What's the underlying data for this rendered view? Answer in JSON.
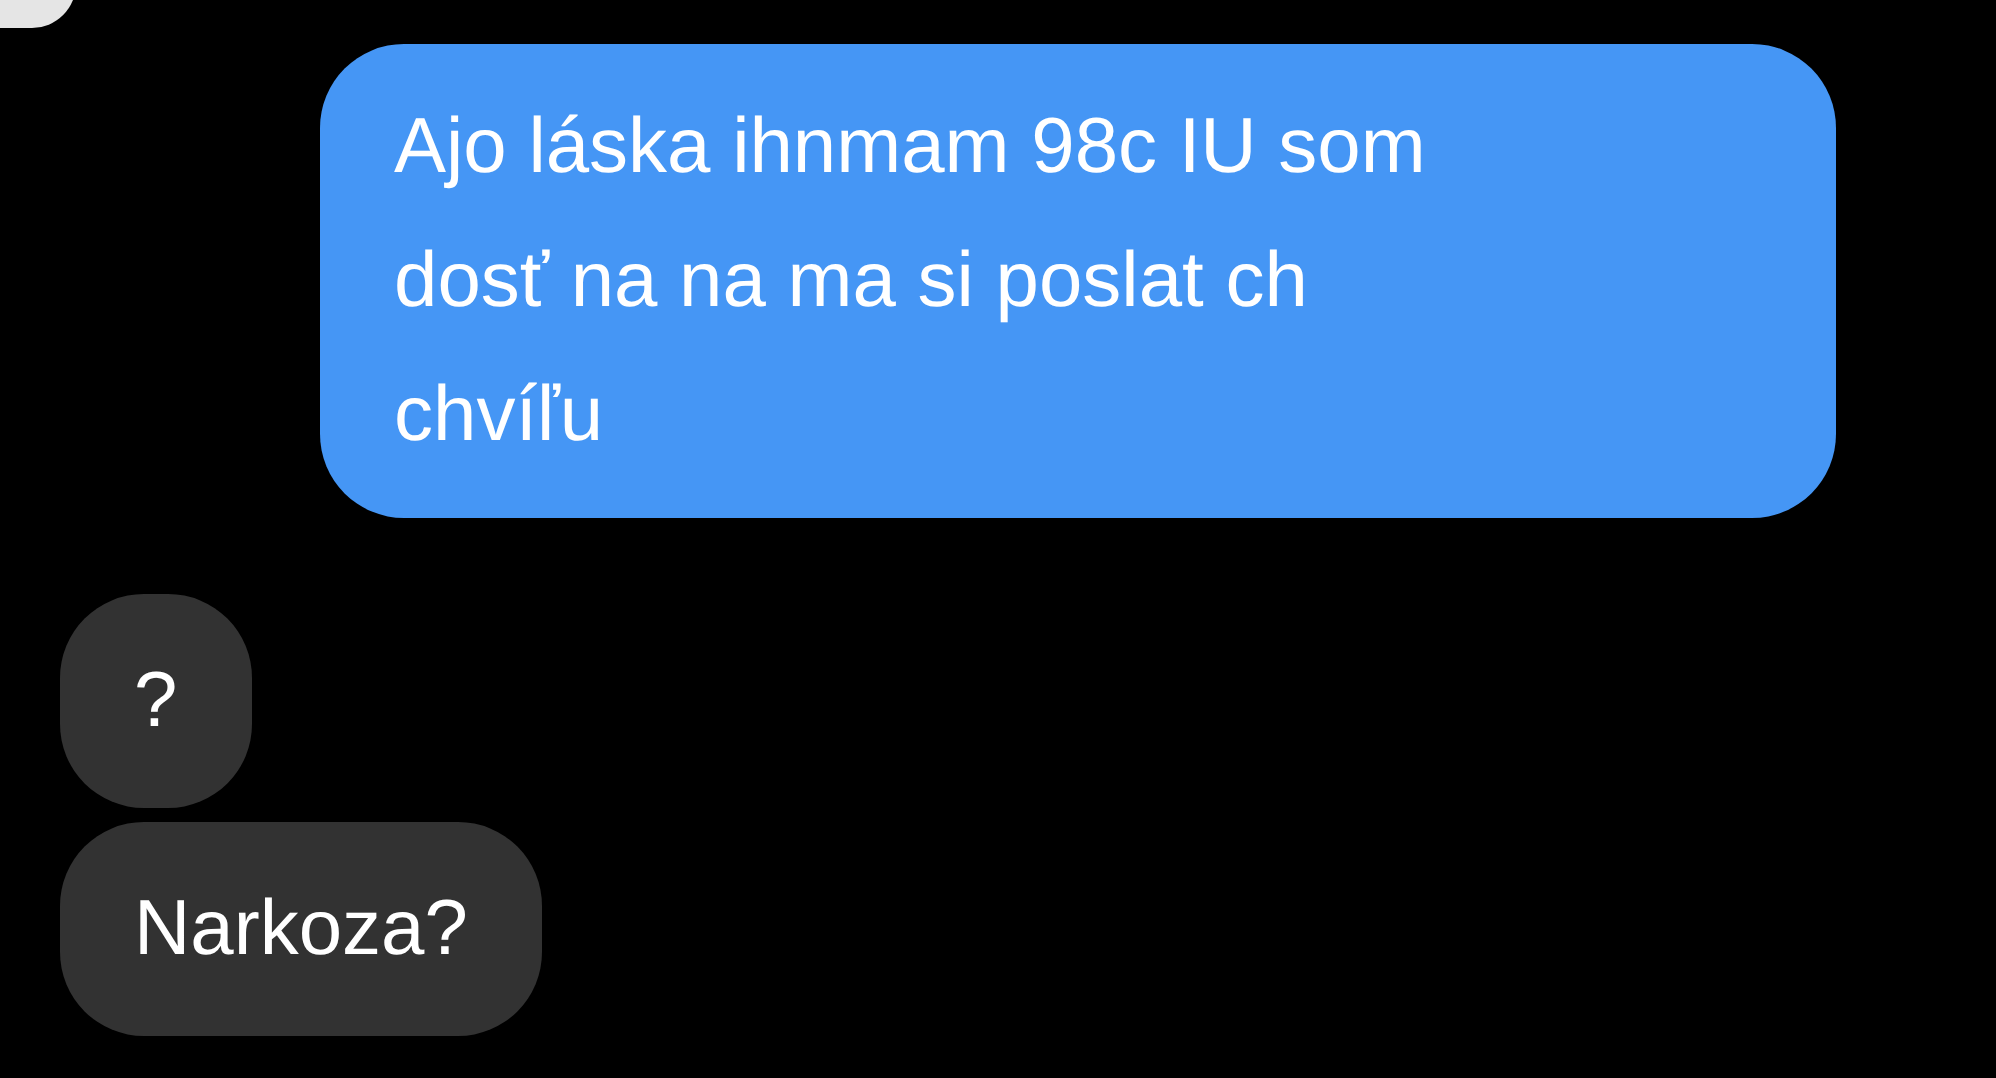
{
  "messages": [
    {
      "kind": "sent",
      "lines": [
        "Ajo láska ihnmam 98c IU som",
        "dosť na na ma si poslat ch",
        "chvíľu"
      ]
    },
    {
      "kind": "received",
      "lines": [
        "?"
      ]
    },
    {
      "kind": "received",
      "lines": [
        "Narkoza?"
      ]
    }
  ]
}
